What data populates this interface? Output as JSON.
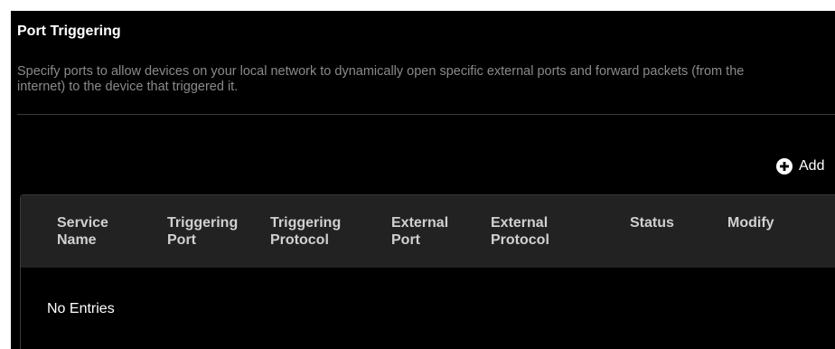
{
  "section": {
    "title": "Port Triggering",
    "description": "Specify ports to allow devices on your local network to dynamically open specific external ports and forward packets (from the internet) to the device that triggered it."
  },
  "toolbar": {
    "add_label": "Add",
    "add_icon": "plus-circle-icon"
  },
  "table": {
    "columns": [
      {
        "line1": "Service",
        "line2": "Name"
      },
      {
        "line1": "Triggering",
        "line2": "Port"
      },
      {
        "line1": "Triggering",
        "line2": "Protocol"
      },
      {
        "line1": "External",
        "line2": "Port"
      },
      {
        "line1": "External",
        "line2": "Protocol"
      },
      {
        "line1": "Status",
        "line2": ""
      },
      {
        "line1": "Modify",
        "line2": ""
      }
    ],
    "empty_message": "No Entries"
  },
  "colors": {
    "background": "#000000",
    "header_background": "#222222",
    "description_text": "#8a8a8a"
  }
}
